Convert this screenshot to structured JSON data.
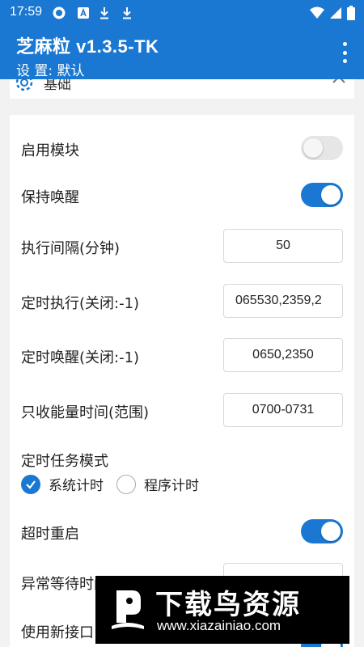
{
  "status_bar": {
    "time": "17:59"
  },
  "app_bar": {
    "title": "芝麻粒 v1.3.5-TK",
    "subtitle": "设 置: 默认"
  },
  "section": {
    "label": "基础"
  },
  "settings": {
    "enable_module": {
      "label": "启用模块",
      "value": false
    },
    "keep_awake": {
      "label": "保持唤醒",
      "value": true
    },
    "interval": {
      "label": "执行间隔(分钟)",
      "value": "50"
    },
    "timed_exec": {
      "label": "定时执行(关闭:-1)",
      "value": "065530,2359,2"
    },
    "timed_wake": {
      "label": "定时唤醒(关闭:-1)",
      "value": "0650,2350"
    },
    "collect_time": {
      "label": "只收能量时间(范围)",
      "value": "0700-0731"
    },
    "timer_mode": {
      "label": "定时任务模式",
      "options": [
        {
          "label": "系统计时",
          "checked": true
        },
        {
          "label": "程序计时",
          "checked": false
        }
      ]
    },
    "timeout_restart": {
      "label": "超时重启",
      "value": true
    },
    "abnormal_wait": {
      "label": "异常等待时间(分钟)"
    },
    "new_api": {
      "label": "使用新接口"
    }
  },
  "watermark": {
    "title": "下载鸟资源",
    "url": "www.xiazainiao.com"
  },
  "colors": {
    "primary": "#1a78d2",
    "background": "#f2f2f2"
  }
}
